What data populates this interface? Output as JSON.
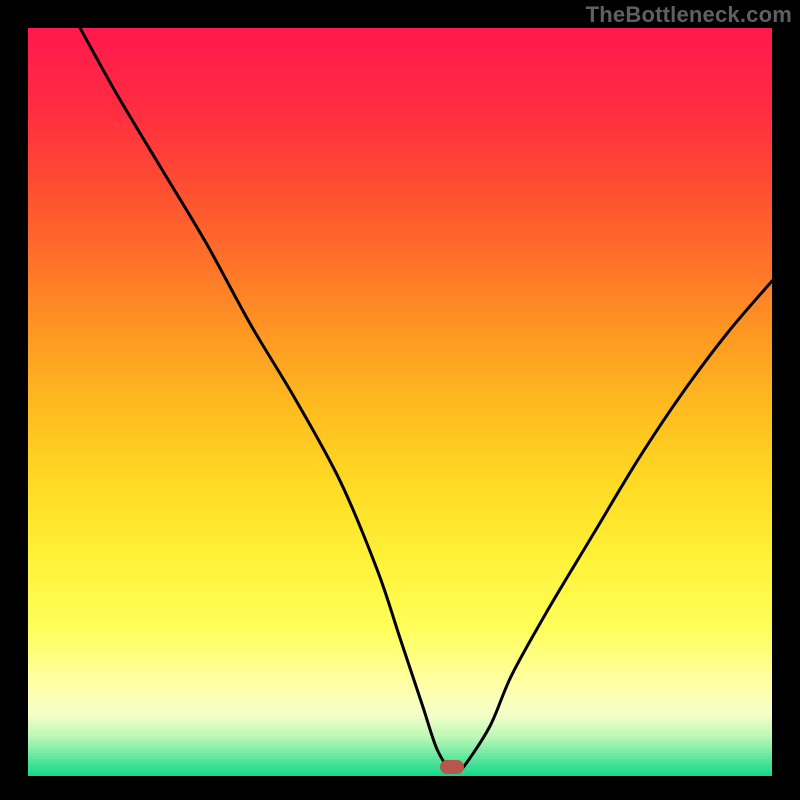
{
  "watermark": "TheBottleneck.com",
  "colors": {
    "black": "#000000",
    "curve": "#000000",
    "marker": "#b7564a"
  },
  "gradient_stops": [
    {
      "offset": 0.0,
      "color": "#ff1a4d"
    },
    {
      "offset": 0.1,
      "color": "#ff2b41"
    },
    {
      "offset": 0.2,
      "color": "#ff4a33"
    },
    {
      "offset": 0.3,
      "color": "#ff6e2a"
    },
    {
      "offset": 0.4,
      "color": "#ff9523"
    },
    {
      "offset": 0.5,
      "color": "#ffb91f"
    },
    {
      "offset": 0.6,
      "color": "#ffd823"
    },
    {
      "offset": 0.7,
      "color": "#fff035"
    },
    {
      "offset": 0.8,
      "color": "#ffff58"
    },
    {
      "offset": 0.88,
      "color": "#ffffa8"
    },
    {
      "offset": 0.92,
      "color": "#f2ffc8"
    },
    {
      "offset": 0.95,
      "color": "#baf7b5"
    },
    {
      "offset": 0.975,
      "color": "#68e8a0"
    },
    {
      "offset": 1.0,
      "color": "#17d98c"
    }
  ],
  "chart_data": {
    "type": "line",
    "title": "",
    "xlabel": "",
    "ylabel": "",
    "xlim": [
      0,
      100
    ],
    "ylim": [
      0,
      100
    ],
    "legend": false,
    "grid": false,
    "series": [
      {
        "name": "bottleneck-curve",
        "x": [
          7,
          12,
          18,
          24,
          30,
          36,
          42,
          47,
          50,
          53,
          55,
          57,
          58,
          62,
          65,
          70,
          76,
          82,
          88,
          94,
          100
        ],
        "y": [
          100,
          91,
          81,
          71,
          60,
          50,
          39,
          27,
          18,
          9,
          3,
          0,
          0,
          6,
          13,
          22,
          32,
          42,
          51,
          59,
          66
        ]
      }
    ],
    "annotations": [
      {
        "name": "optimum-marker",
        "x": 57,
        "y": 0.7,
        "shape": "pill",
        "color": "#b7564a"
      }
    ],
    "background": "vertical-gradient"
  }
}
